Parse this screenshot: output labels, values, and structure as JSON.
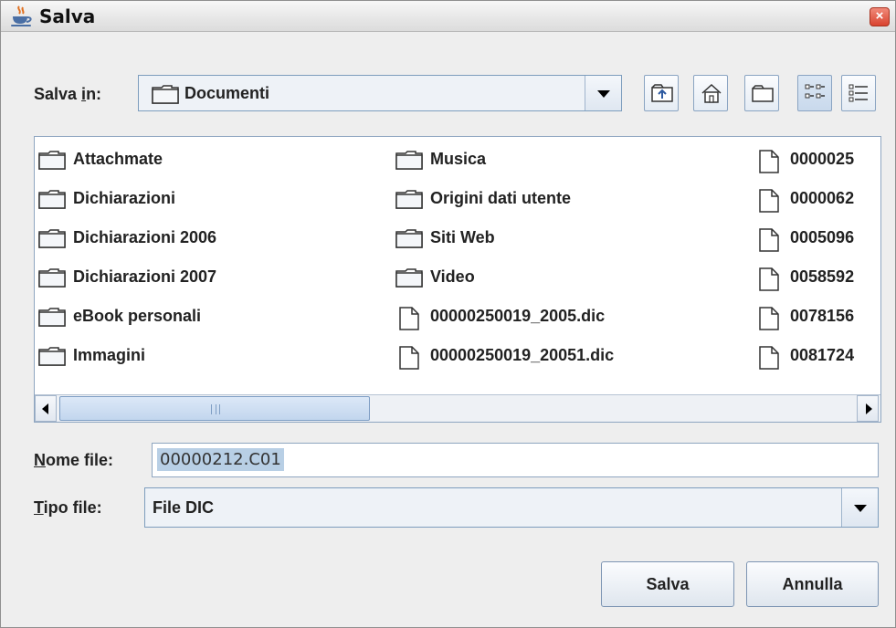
{
  "window": {
    "title": "Salva",
    "close_glyph": "×",
    "icon": "java-cup-icon"
  },
  "location": {
    "label_prefix": "Salva ",
    "label_mnemonic": "i",
    "label_suffix": "n:",
    "current": "Documenti"
  },
  "toolbar": {
    "buttons": [
      "up-one-level-icon",
      "home-icon",
      "new-folder-icon",
      "list-view-icon",
      "details-view-icon"
    ],
    "active": "list-view-icon"
  },
  "files": {
    "col1": [
      "Attachmate",
      "Dichiarazioni",
      "Dichiarazioni 2006",
      "Dichiarazioni 2007",
      "eBook personali",
      "Immagini"
    ],
    "col2": [
      "Musica",
      "Origini dati utente",
      "Siti Web",
      "Video",
      "00000250019_2005.dic",
      "00000250019_20051.dic"
    ],
    "col3": [
      "0000025",
      "0000062",
      "0005096",
      "0058592",
      "0078156",
      "0081724"
    ],
    "col1_types": [
      "folder",
      "folder",
      "folder",
      "folder",
      "folder",
      "folder"
    ],
    "col2_types": [
      "folder",
      "folder",
      "folder",
      "folder",
      "file",
      "file"
    ],
    "col3_types": [
      "file",
      "file",
      "file",
      "file",
      "file",
      "file"
    ]
  },
  "filename": {
    "label_mnemonic": "N",
    "label_rest": "ome file:",
    "value": "00000212.C01"
  },
  "filetype": {
    "label_mnemonic": "T",
    "label_rest": "ipo file:",
    "value": "File DIC"
  },
  "actions": {
    "save": "Salva",
    "cancel": "Annulla"
  },
  "colors": {
    "window_bg": "#eeeeee",
    "accent_border": "#7d9dbd",
    "selection": "#b8cfe5",
    "close_red": "#d9432f"
  }
}
